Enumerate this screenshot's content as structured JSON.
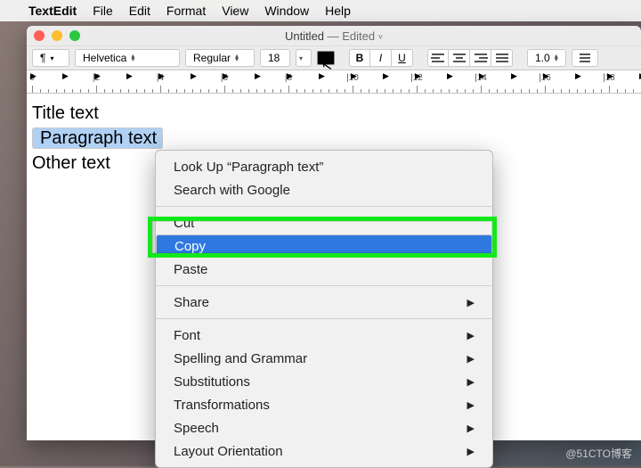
{
  "menubar": {
    "app_name": "TextEdit",
    "items": [
      "File",
      "Edit",
      "Format",
      "View",
      "Window",
      "Help"
    ]
  },
  "window": {
    "title_name": "Untitled",
    "title_dash": " — ",
    "title_state": "Edited"
  },
  "toolbar": {
    "style": "¶",
    "font_family": "Helvetica",
    "font_weight": "Regular",
    "font_size": "18",
    "line_spacing": "1.0",
    "b": "B",
    "i": "I",
    "u": "U"
  },
  "document": {
    "line1": "Title text",
    "line2": "Paragraph text",
    "line3": "Other text"
  },
  "context_menu": {
    "lookup": "Look Up “Paragraph text”",
    "google": "Search with Google",
    "cut": "Cut",
    "copy": "Copy",
    "paste": "Paste",
    "share": "Share",
    "font": "Font",
    "spelling": "Spelling and Grammar",
    "subs": "Substitutions",
    "trans": "Transformations",
    "speech": "Speech",
    "layout": "Layout Orientation"
  },
  "ruler": {
    "marks": [
      "0",
      "|2",
      "|4",
      "|6",
      "|8",
      "|10",
      "|12",
      "|14",
      "|16",
      "|18"
    ]
  },
  "watermark": "@51CTO博客"
}
